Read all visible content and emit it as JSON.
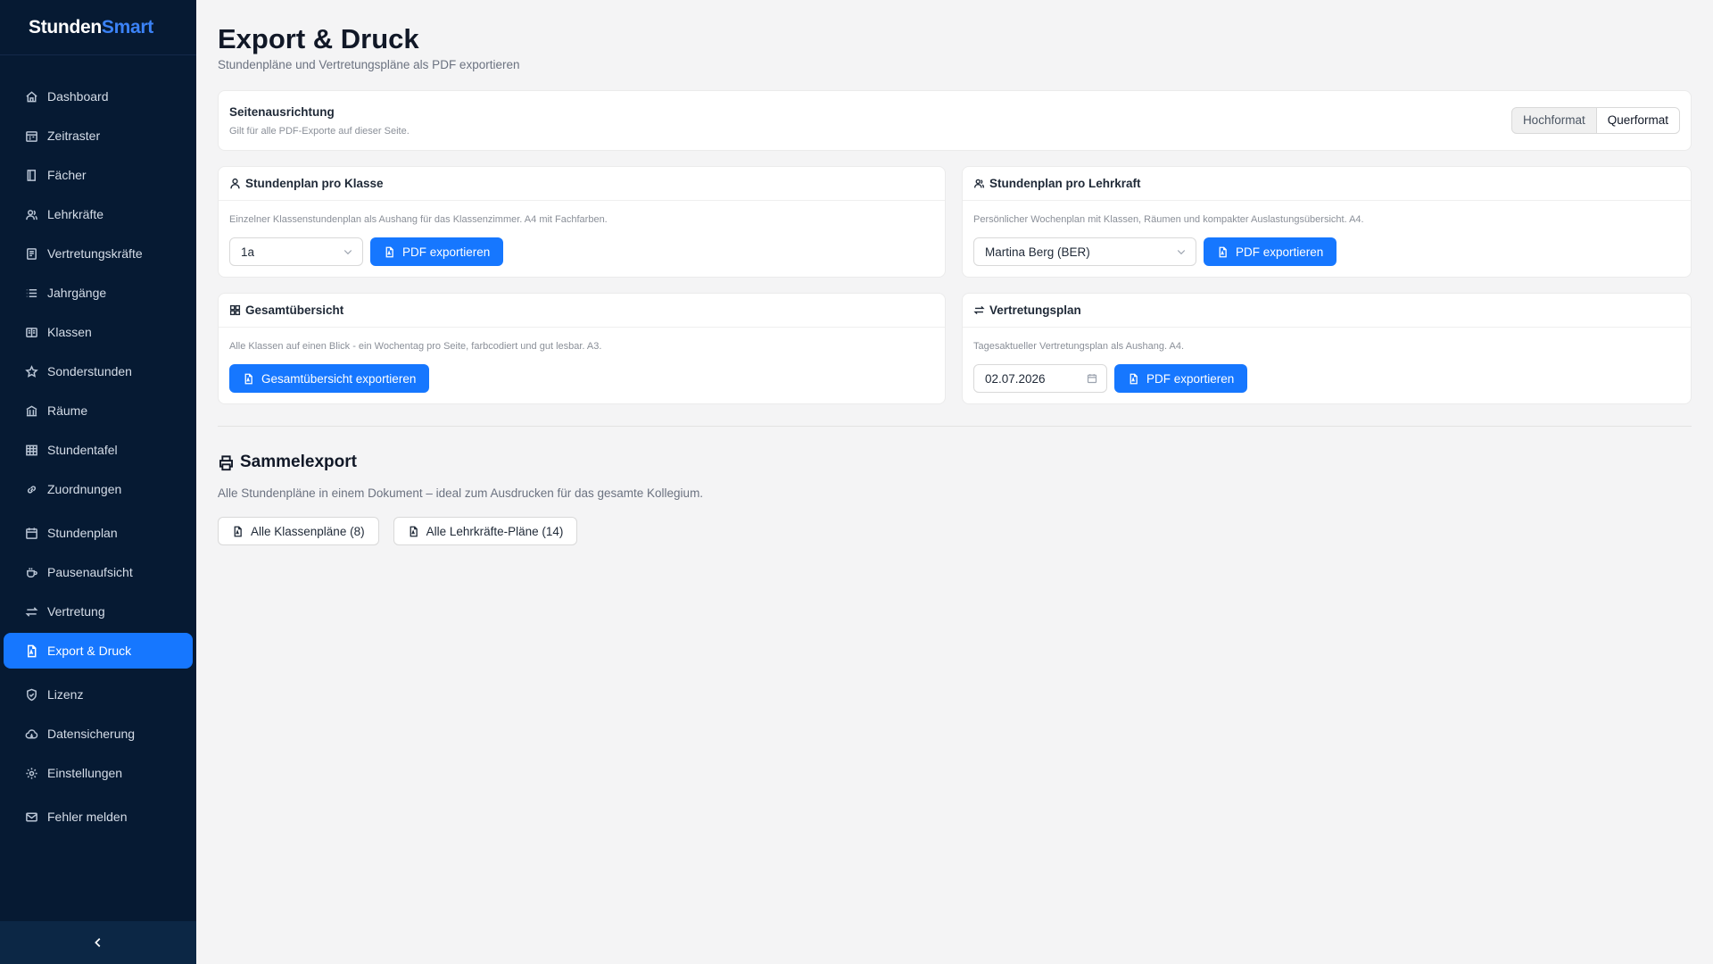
{
  "app": {
    "brand_part1": "Stunden",
    "brand_part2": "Smart"
  },
  "sidebar": {
    "items": [
      {
        "label": "Dashboard",
        "icon": "home-icon"
      },
      {
        "label": "Zeitraster",
        "icon": "calendar-grid-icon"
      },
      {
        "label": "Fächer",
        "icon": "book-icon"
      },
      {
        "label": "Lehrkräfte",
        "icon": "users-icon"
      },
      {
        "label": "Vertretungskräfte",
        "icon": "id-card-icon"
      },
      {
        "label": "Jahrgänge",
        "icon": "list-icon"
      },
      {
        "label": "Klassen",
        "icon": "open-book-icon"
      },
      {
        "label": "Sonderstunden",
        "icon": "star-icon"
      },
      {
        "label": "Räume",
        "icon": "bank-icon"
      },
      {
        "label": "Stundentafel",
        "icon": "table-icon"
      },
      {
        "label": "Zuordnungen",
        "icon": "link-icon"
      },
      {
        "label": "Stundenplan",
        "icon": "calendar-icon"
      },
      {
        "label": "Pausenaufsicht",
        "icon": "coffee-icon"
      },
      {
        "label": "Vertretung",
        "icon": "swap-icon"
      },
      {
        "label": "Export & Druck",
        "icon": "pdf-file-icon",
        "active": true
      },
      {
        "label": "Lizenz",
        "icon": "shield-icon"
      },
      {
        "label": "Datensicherung",
        "icon": "cloud-icon"
      },
      {
        "label": "Einstellungen",
        "icon": "gear-icon"
      },
      {
        "label": "Fehler melden",
        "icon": "mail-icon"
      }
    ],
    "collapse_icon": "chevron-left-icon"
  },
  "page": {
    "title": "Export & Druck",
    "subtitle": "Stundenpläne und Vertretungspläne als PDF exportieren"
  },
  "orientation": {
    "title": "Seitenausrichtung",
    "description": "Gilt für alle PDF-Exporte auf dieser Seite.",
    "options": [
      "Hochformat",
      "Querformat"
    ],
    "selected": "Querformat"
  },
  "cards": {
    "klasse": {
      "title": "Stundenplan pro Klasse",
      "description": "Einzelner Klassenstundenplan als Aushang für das Klassenzimmer. A4 mit Fachfarben.",
      "select_value": "1a",
      "button": "PDF exportieren"
    },
    "lehrkraft": {
      "title": "Stundenplan pro Lehrkraft",
      "description": "Persönlicher Wochenplan mit Klassen, Räumen und kompakter Auslastungsübersicht. A4.",
      "select_value": "Martina Berg (BER)",
      "button": "PDF exportieren"
    },
    "gesamt": {
      "title": "Gesamtübersicht",
      "description": "Alle Klassen auf einen Blick - ein Wochentag pro Seite, farbcodiert und gut lesbar. A3.",
      "button": "Gesamtübersicht exportieren"
    },
    "vertretung": {
      "title": "Vertretungsplan",
      "description": "Tagesaktueller Vertretungsplan als Aushang. A4.",
      "date_value": "02.07.2026",
      "button": "PDF exportieren"
    }
  },
  "sammel": {
    "title": "Sammelexport",
    "description": "Alle Stundenpläne in einem Dokument – ideal zum Ausdrucken für das gesamte Kollegium.",
    "buttons": [
      "Alle Klassenpläne (8)",
      "Alle Lehrkräfte-Pläne (14)"
    ]
  },
  "colors": {
    "sidebar_bg": "#061a33",
    "accent": "#1677ff",
    "brand_accent": "#3b82f6"
  }
}
